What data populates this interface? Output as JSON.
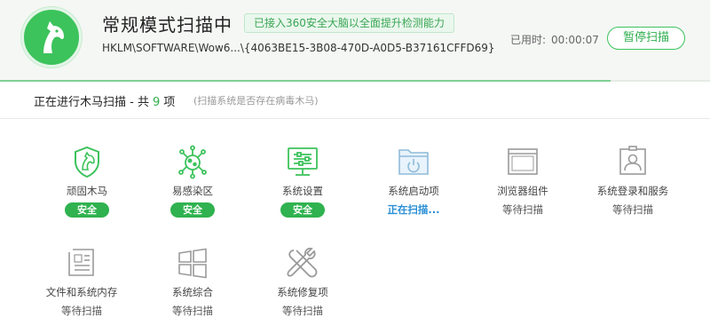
{
  "colors": {
    "accent": "#3cc35c",
    "safe": "#2fb24f",
    "scanning": "#2a8fd6"
  },
  "header": {
    "logo_icon": "horse-shield-icon",
    "title": "常规模式扫描中",
    "tag": "已接入360安全大脑以全面提升检测能力",
    "path": "HKLM\\SOFTWARE\\Wow6...\\{4063BE15-3B08-470D-A0D5-B37161CFFD69}",
    "elapsed_label": "已用时:",
    "elapsed_time": "00:00:07",
    "pause_label": "暂停扫描",
    "progress": 0.86
  },
  "section": {
    "prefix": "正在进行木马扫描 - 共",
    "count": "9",
    "suffix": "项",
    "hint": "(扫描系统是否存在病毒木马)"
  },
  "items": [
    {
      "label": "顽固木马",
      "status": "安全",
      "state": "safe",
      "icon": "horse-shield-icon"
    },
    {
      "label": "易感染区",
      "status": "安全",
      "state": "safe",
      "icon": "virus-icon"
    },
    {
      "label": "系统设置",
      "status": "安全",
      "state": "safe",
      "icon": "monitor-settings-icon"
    },
    {
      "label": "系统启动项",
      "status": "正在扫描...",
      "state": "scanning",
      "icon": "startup-folder-icon"
    },
    {
      "label": "浏览器组件",
      "status": "等待扫描",
      "state": "waiting",
      "icon": "browser-window-icon"
    },
    {
      "label": "系统登录和服务",
      "status": "等待扫描",
      "state": "waiting",
      "icon": "user-card-icon"
    },
    {
      "label": "文件和系统内存",
      "status": "等待扫描",
      "state": "waiting",
      "icon": "document-icon"
    },
    {
      "label": "系统综合",
      "status": "等待扫描",
      "state": "waiting",
      "icon": "windows-logo-icon"
    },
    {
      "label": "系统修复项",
      "status": "等待扫描",
      "state": "waiting",
      "icon": "tools-icon"
    }
  ]
}
